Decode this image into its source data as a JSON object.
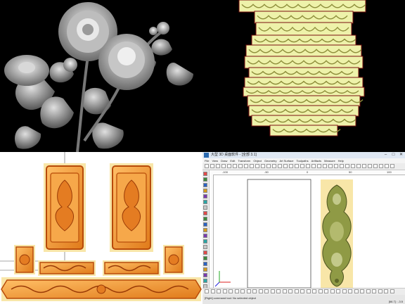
{
  "cad_window": {
    "title": "大型 3D 桌面软件 - [全部 3.1]",
    "window_controls": [
      "–",
      "□",
      "✕"
    ],
    "menus": [
      "File",
      "View",
      "Draw",
      "Edit",
      "Transform",
      "Object",
      "Geometry",
      "Art Surface",
      "Toolpaths",
      "Artifacts",
      "Measure",
      "Help"
    ],
    "ruler_labels": [
      "-100",
      "-50",
      "0",
      "50",
      "100"
    ],
    "status_text": "[Right] command tool: No selected object",
    "coords": "[66.7] : -3.5"
  },
  "colors": {
    "relief_gray": "#a9a9a9",
    "frieze_fill": "#eef2aa",
    "frieze_border": "#7a1010",
    "carving_orange": "#f09a3c",
    "carving_dark": "#b84a0a",
    "panel_background": "#f8e6a8",
    "cad_relief_green": "#8f9a45"
  },
  "icons": [
    "flower-relief",
    "frieze-strip",
    "carved-panel",
    "toolbar-button",
    "axis-gizmo"
  ]
}
